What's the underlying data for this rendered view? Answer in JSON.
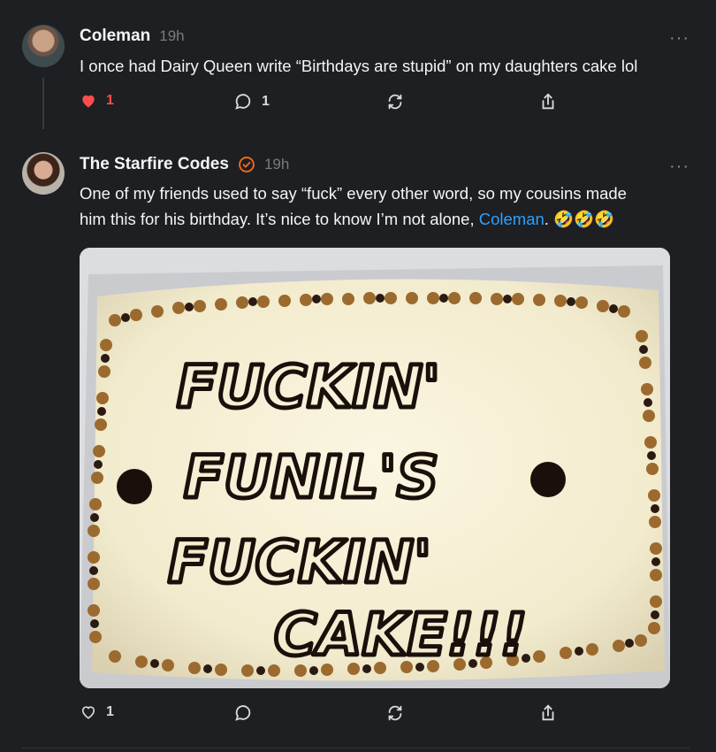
{
  "posts": [
    {
      "username": "Coleman",
      "time": "19h",
      "more": "···",
      "text": "I once had Dairy Queen write “Birthdays are stupid” on my daughters cake lol",
      "likes": "1",
      "replies": "1"
    },
    {
      "username": "The Starfire Codes",
      "time": "19h",
      "more": "···",
      "text_line1": "One of my friends used to say “fuck” every other word, so my cousins made",
      "text_line2_before": "him this for his birthday. It’s nice to know I’m not alone, ",
      "mention": "Coleman",
      "text_line2_after": ". 🤣🤣🤣",
      "image_text": [
        "FUCKIN'",
        "FUNIL'S",
        "FUCKIN'",
        "CAKE!!!"
      ],
      "likes": "1",
      "replies": ""
    }
  ],
  "icons": {
    "like_active": "heart-filled-icon",
    "like": "heart-outline-icon",
    "reply": "comment-icon",
    "repost": "repost-icon",
    "share": "share-icon",
    "verified": "verified-badge-icon"
  },
  "colors": {
    "background": "#1e1f22",
    "like_active": "#ff4d4d",
    "mention": "#2da1ff",
    "verified": "#ff6a13"
  }
}
